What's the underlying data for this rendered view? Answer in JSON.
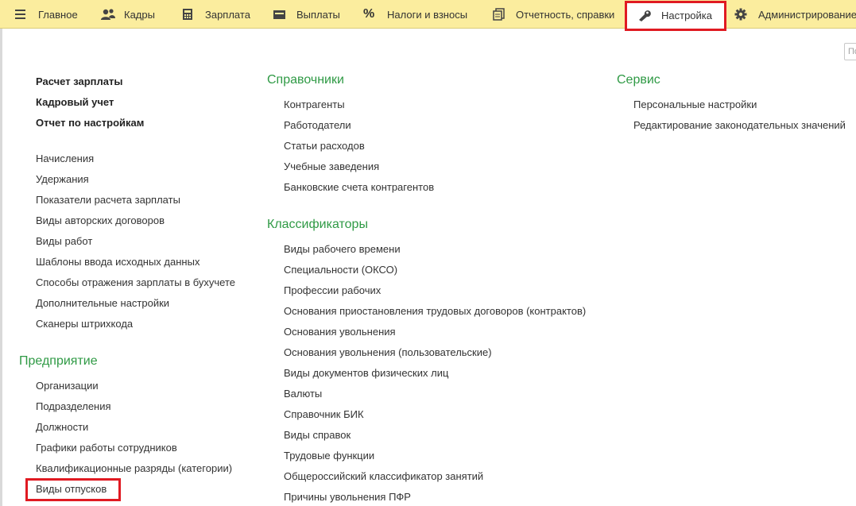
{
  "sections": [
    {
      "label": "Главное",
      "icon": "hamburger-icon"
    },
    {
      "label": "Кадры",
      "icon": "people-icon"
    },
    {
      "label": "Зарплата",
      "icon": "calculator-icon"
    },
    {
      "label": "Выплаты",
      "icon": "wallet-icon"
    },
    {
      "label": "Налоги и взносы",
      "icon": "percent-icon"
    },
    {
      "label": "Отчетность, справки",
      "icon": "reports-icon"
    },
    {
      "label": "Настройка",
      "icon": "wrench-icon"
    },
    {
      "label": "Администрирование",
      "icon": "gear-icon"
    }
  ],
  "search": {
    "placeholder": "Поиск"
  },
  "main_links": [
    "Расчет зарплаты",
    "Кадровый учет",
    "Отчет по настройкам"
  ],
  "payroll_links": [
    "Начисления",
    "Удержания",
    "Показатели расчета зарплаты",
    "Виды авторских договоров",
    "Виды работ",
    "Шаблоны ввода исходных данных",
    "Способы отражения зарплаты в бухучете",
    "Дополнительные настройки",
    "Сканеры штрихкода"
  ],
  "enterprise": {
    "title": "Предприятие",
    "items": [
      "Организации",
      "Подразделения",
      "Должности",
      "Графики работы сотрудников",
      "Квалификационные разряды (категории)",
      "Виды отпусков"
    ]
  },
  "references": {
    "title": "Справочники",
    "items": [
      "Контрагенты",
      "Работодатели",
      "Статьи расходов",
      "Учебные заведения",
      "Банковские счета контрагентов"
    ]
  },
  "classifiers": {
    "title": "Классификаторы",
    "items": [
      "Виды рабочего времени",
      "Специальности (ОКСО)",
      "Профессии рабочих",
      "Основания приостановления трудовых договоров (контрактов)",
      "Основания увольнения",
      "Основания увольнения (пользовательские)",
      "Виды документов физических лиц",
      "Валюты",
      "Справочник БИК",
      "Виды справок",
      "Трудовые функции",
      "Общероссийский классификатор занятий",
      "Причины увольнения ПФР"
    ]
  },
  "service": {
    "title": "Сервис",
    "items": [
      "Персональные настройки",
      "Редактирование законодательных значений"
    ]
  },
  "colors": {
    "topbar_bg": "#fbed9e",
    "group_title": "#2f9a45",
    "highlight": "#e01a22"
  }
}
